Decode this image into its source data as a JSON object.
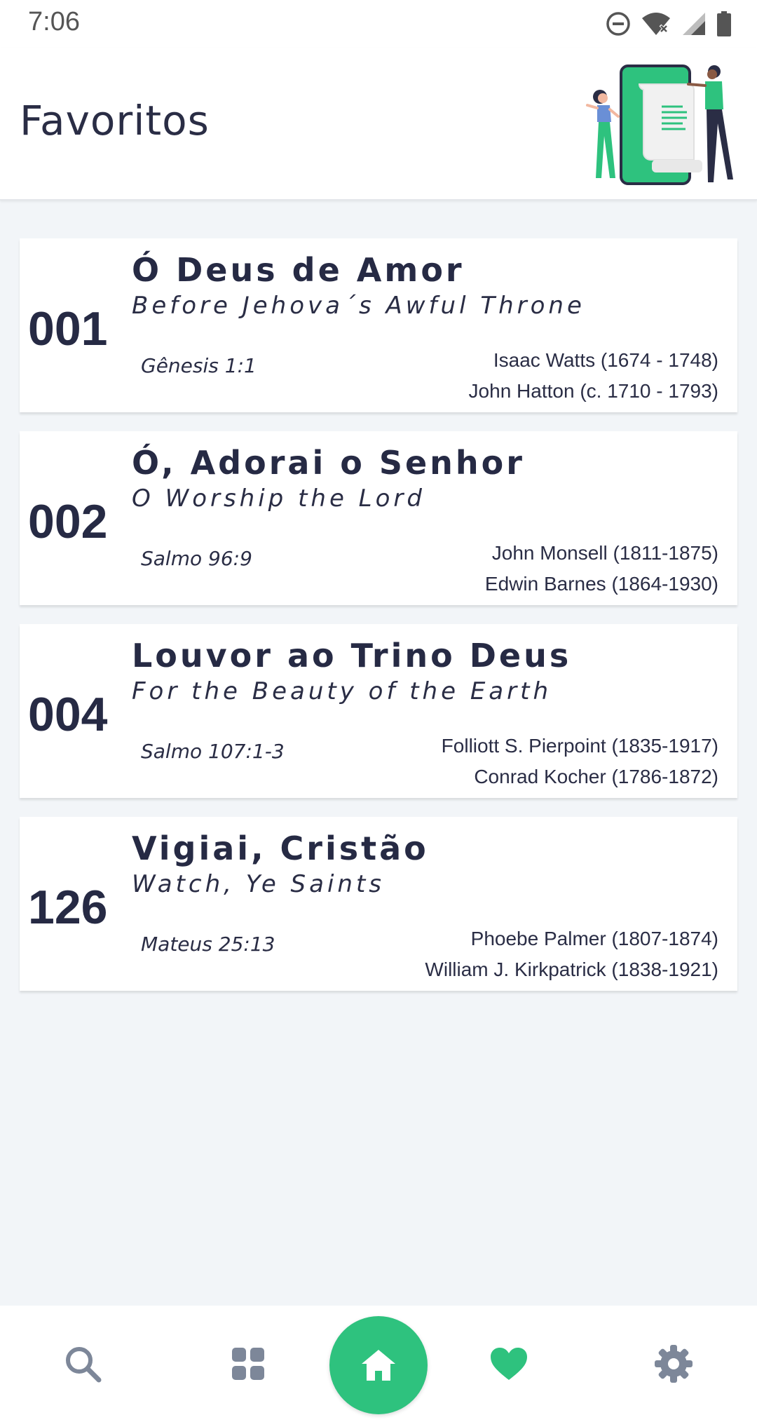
{
  "status_bar": {
    "time": "7:06",
    "icons": [
      "do-not-disturb-icon",
      "wifi-off-icon",
      "signal-icon",
      "battery-icon"
    ]
  },
  "header": {
    "title": "Favoritos"
  },
  "hymns": [
    {
      "number": "001",
      "title": "Ó Deus de Amor",
      "original_title": "Before Jehova´s Awful Throne",
      "reference": "Gênesis 1:1",
      "author_1": "Isaac Watts (1674 - 1748)",
      "author_2": "John Hatton (c. 1710 - 1793)"
    },
    {
      "number": "002",
      "title": "Ó, Adorai o Senhor",
      "original_title": "O Worship the Lord",
      "reference": "Salmo 96:9",
      "author_1": "John Monsell (1811-1875)",
      "author_2": "Edwin Barnes (1864-1930)"
    },
    {
      "number": "004",
      "title": "Louvor ao Trino Deus",
      "original_title": "For the Beauty of the Earth",
      "reference": "Salmo 107:1-3",
      "author_1": "Folliott S. Pierpoint (1835-1917)",
      "author_2": "Conrad Kocher (1786-1872)"
    },
    {
      "number": "126",
      "title": "Vigiai, Cristão",
      "original_title": "Watch, Ye Saints",
      "reference": "Mateus 25:13",
      "author_1": "Phoebe Palmer (1807-1874)",
      "author_2": "William J. Kirkpatrick (1838-1921)"
    }
  ],
  "bottom_nav": {
    "items": [
      "search-icon",
      "grid-icon",
      "home-icon",
      "heart-icon",
      "gear-icon"
    ],
    "active": "heart-icon"
  },
  "colors": {
    "accent": "#2ec27e",
    "text": "#262a44",
    "nav_icon": "#7d8799",
    "background": "#f2f5f8"
  }
}
